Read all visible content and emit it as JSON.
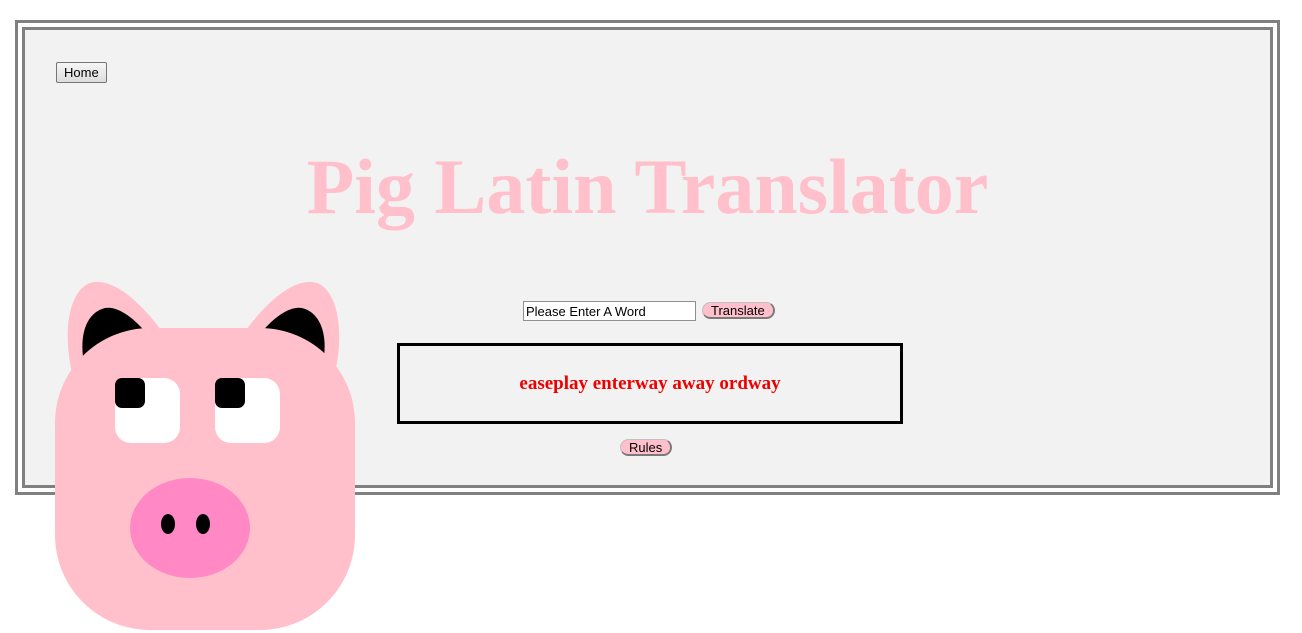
{
  "nav": {
    "home_label": "Home"
  },
  "title": "Pig Latin Translator",
  "translator": {
    "input_value": "Please Enter A Word",
    "translate_label": "Translate",
    "result_text": "easeplay enterway away ordway",
    "rules_label": "Rules"
  },
  "mascot": {
    "icon": "pig-face-icon"
  },
  "colors": {
    "title": "#ffc0cb",
    "button_bg": "#ffc0cb",
    "result_text": "#ee0000",
    "panel_bg": "#f2f2f2",
    "frame_border": "#808080",
    "pig_skin": "#ffc0cb",
    "pig_snout": "#ff88c5"
  }
}
